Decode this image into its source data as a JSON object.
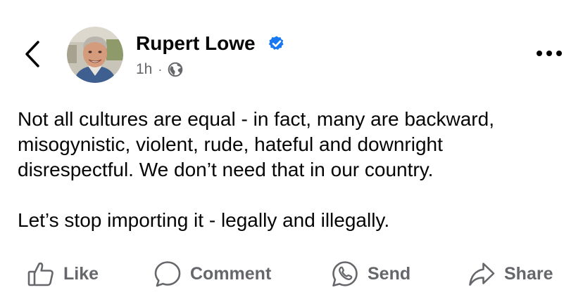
{
  "post": {
    "author": "Rupert Lowe",
    "verified": true,
    "timestamp": "1h",
    "separator": "·",
    "audience_icon": "globe-icon",
    "paragraphs": [
      "Not all cultures are equal - in fact, many are backward,\nmisogynistic, violent, rude, hateful and downright\ndisrespectful. We don’t need that in our country.",
      "Let’s stop importing it - legally and illegally."
    ]
  },
  "actions": {
    "like": "Like",
    "comment": "Comment",
    "send": "Send",
    "share": "Share"
  },
  "colors": {
    "text": "#050505",
    "secondary_text": "#65676b",
    "verified_badge": "#1877f2",
    "background": "#ffffff"
  }
}
